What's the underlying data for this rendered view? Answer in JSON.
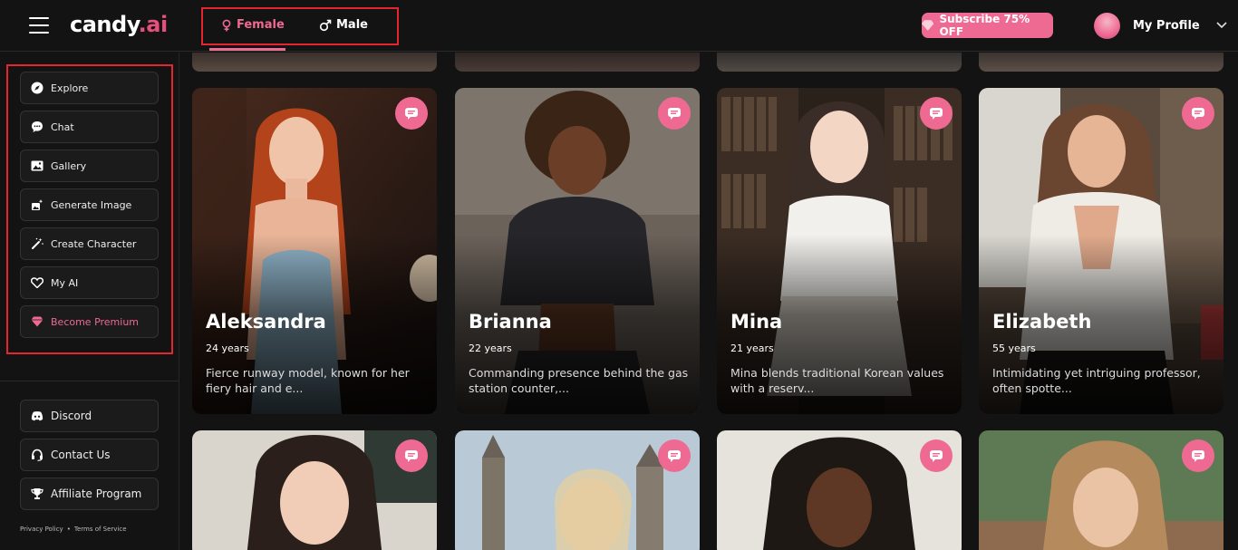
{
  "header": {
    "logo_main": "candy",
    "logo_dot": ".",
    "logo_tld": "ai",
    "tabs": [
      {
        "label": "Female",
        "icon": "female-symbol-icon",
        "active": true
      },
      {
        "label": "Male",
        "icon": "male-symbol-icon",
        "active": false
      }
    ],
    "subscribe_label": "Subscribe 75% OFF",
    "profile_label": "My Profile"
  },
  "sidebar": {
    "items": [
      {
        "label": "Explore",
        "icon": "compass-icon"
      },
      {
        "label": "Chat",
        "icon": "chat-bubble-icon"
      },
      {
        "label": "Gallery",
        "icon": "image-icon"
      },
      {
        "label": "Generate Image",
        "icon": "magic-image-icon"
      },
      {
        "label": "Create Character",
        "icon": "magic-wand-icon"
      },
      {
        "label": "My AI",
        "icon": "heart-icon"
      },
      {
        "label": "Become Premium",
        "icon": "diamond-icon"
      }
    ],
    "lower_items": [
      {
        "label": "Discord",
        "icon": "discord-icon"
      },
      {
        "label": "Contact Us",
        "icon": "headset-icon"
      },
      {
        "label": "Affiliate Program",
        "icon": "trophy-icon"
      }
    ],
    "footer": {
      "privacy": "Privacy Policy",
      "separator": "•",
      "terms": "Terms of Service"
    }
  },
  "cards": [
    {
      "name": "Aleksandra",
      "age": "24 years",
      "description": "Fierce runway model, known for her fiery hair and e..."
    },
    {
      "name": "Brianna",
      "age": "22 years",
      "description": "Commanding presence behind the gas station counter,..."
    },
    {
      "name": "Mina",
      "age": "21 years",
      "description": "Mina blends traditional Korean values with a reserv..."
    },
    {
      "name": "Elizabeth",
      "age": "55 years",
      "description": "Intimidating yet intriguing professor, often spotte..."
    }
  ],
  "colors": {
    "accent": "#ef6a92",
    "highlight_box": "#e3262f",
    "background": "#131313"
  }
}
